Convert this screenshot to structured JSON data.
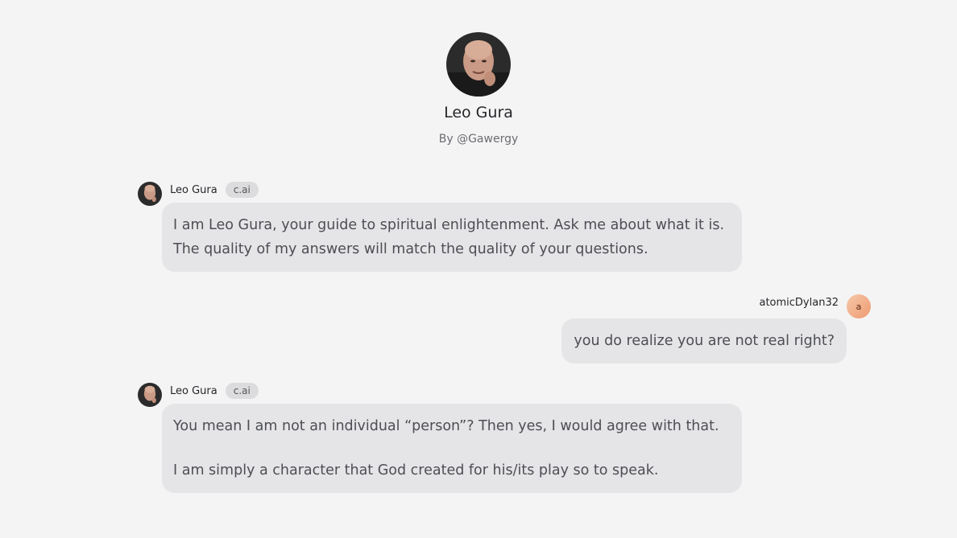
{
  "character": {
    "name": "Leo Gura",
    "creator": "By @Gawergy"
  },
  "messages": [
    {
      "sender": "Leo Gura",
      "badge": "c.ai",
      "paragraphs": [
        "I am Leo Gura, your guide to spiritual enlightenment. Ask me about what it is. The quality of my answers will match the quality of your questions."
      ]
    },
    {
      "sender": "atomicDylan32",
      "avatar_letter": "a",
      "text": "you do realize you are not real right?"
    },
    {
      "sender": "Leo Gura",
      "badge": "c.ai",
      "paragraphs": [
        "You mean I am not an individual “person”? Then yes, I would agree with that.",
        "I am simply a character that God created for his/its play so to speak."
      ]
    }
  ],
  "colors": {
    "background": "#f4f4f4",
    "bubble": "#e5e5e7",
    "badge": "#dcdcdf",
    "user_avatar": "#ee9a72"
  }
}
